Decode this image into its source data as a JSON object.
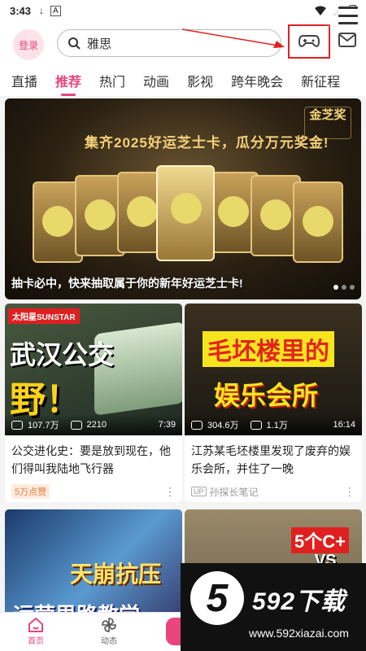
{
  "status_bar": {
    "time": "3:43",
    "download_glyph": "↓",
    "a_glyph": "A"
  },
  "header": {
    "login_label": "登录",
    "search_value": "雅思",
    "icons": {
      "search": "search-icon",
      "game": "gamepad-icon",
      "mail": "mail-icon"
    }
  },
  "tabs": [
    "直播",
    "推荐",
    "热门",
    "动画",
    "影视",
    "跨年晚会",
    "新征程"
  ],
  "active_tab": "推荐",
  "banner": {
    "headline": "集齐2025好运芝士卡，瓜分万元奖金!",
    "badge": "金芝奖",
    "caption": "抽卡必中，快来抽取属于你的新年好运芝士卡!"
  },
  "videos": [
    {
      "thumb_logo": "太阳星SUNSTAR",
      "thumb_text_1": "武汉公交",
      "thumb_text_2": "野！",
      "plays": "107.7万",
      "danmaku": "2210",
      "duration": "7:39",
      "title": "公交进化史：要是放到现在，他们得叫我陆地飞行器",
      "tag": "5万点赞"
    },
    {
      "thumb_text_1": "毛坯楼里的",
      "thumb_text_2": "娱乐会所",
      "plays": "304.6万",
      "danmaku": "1.1万",
      "duration": "16:14",
      "title": "江苏某毛坯楼里发现了废弃的娱乐会所，并住了一晚",
      "up_badge": "UP",
      "author": "孙探长笔记"
    },
    {
      "thumb_text_1": "天崩抗压",
      "thumb_text_2": "运营思路教学"
    },
    {
      "thumb_text_1": "5个C+",
      "thumb_text_2": "VS."
    }
  ],
  "bottom_nav": {
    "home": "首页",
    "feed": "动态"
  },
  "watermark": {
    "digit": "5",
    "name": "592下载",
    "url": "www.592xiazai.com"
  },
  "colors": {
    "accent": "#e8457a",
    "highlight_box": "#e02020"
  }
}
